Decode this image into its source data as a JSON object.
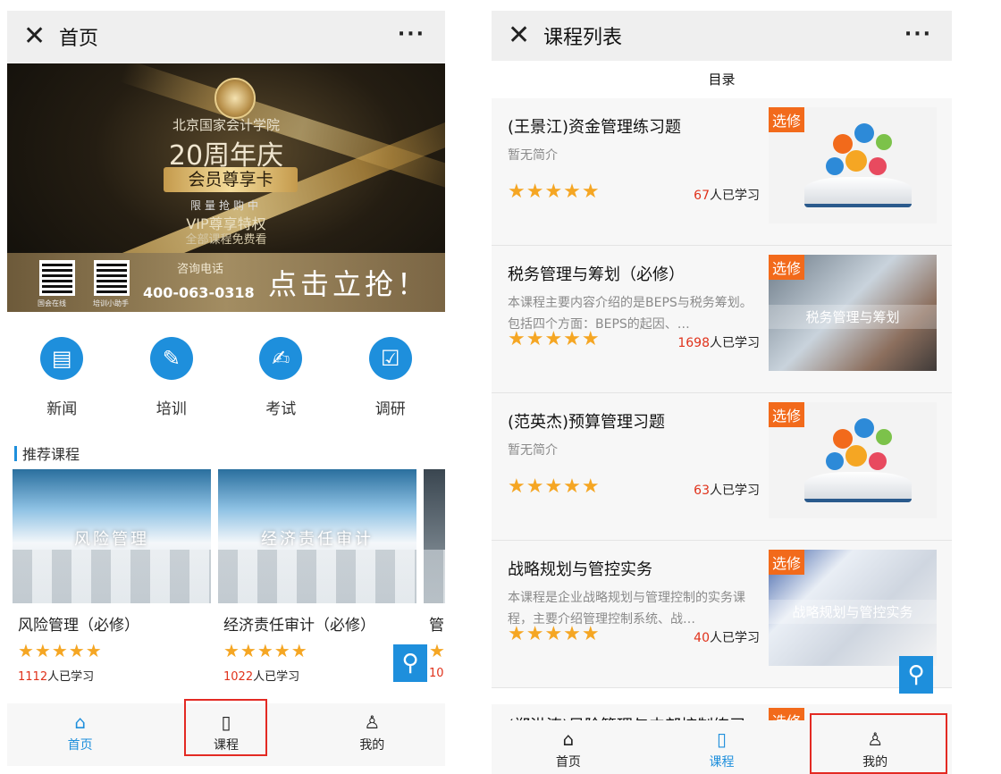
{
  "left": {
    "header": {
      "close_glyph": "✕",
      "title": "首页",
      "more_glyph": "···"
    },
    "banner": {
      "school": "北京国家会计学院",
      "anniversary": "20周年庆",
      "card": "会员尊享卡",
      "limited": "限量抢购中",
      "vip": "VIP尊享特权",
      "free": "全部课程免费看",
      "consult": "咨询电话",
      "phone": "400-063-0318",
      "grab": "点击立抢！",
      "qr1_label": "国会在线",
      "qr2_label": "培训小助手"
    },
    "shortcuts": [
      {
        "label": "新闻",
        "icon": "news-icon",
        "glyph": "▤"
      },
      {
        "label": "培训",
        "icon": "training-icon",
        "glyph": "✎"
      },
      {
        "label": "考试",
        "icon": "exam-icon",
        "glyph": "✍"
      },
      {
        "label": "调研",
        "icon": "survey-icon",
        "glyph": "☑"
      }
    ],
    "recommend_title": "推荐课程",
    "courses": [
      {
        "thumb_text": "风险管理",
        "name": "风险管理（必修）",
        "count": "1112",
        "suffix": "人已学习"
      },
      {
        "thumb_text": "经济责任审计",
        "name": "经济责任审计（必修）",
        "count": "1022",
        "suffix": "人已学习"
      },
      {
        "thumb_text": "",
        "name": "管",
        "count": "10",
        "suffix": ""
      }
    ],
    "stars": "★★★★★",
    "tabs": [
      {
        "label": "首页",
        "icon": "home-icon",
        "glyph": "⌂"
      },
      {
        "label": "课程",
        "icon": "book-icon",
        "glyph": "▯"
      },
      {
        "label": "我的",
        "icon": "user-icon",
        "glyph": "♙"
      }
    ]
  },
  "right": {
    "header": {
      "close_glyph": "✕",
      "title": "课程列表",
      "more_glyph": "···"
    },
    "catalog": "目录",
    "elective": "选修",
    "stars": "★★★★★",
    "items": [
      {
        "title": "(王景江)资金管理练习题",
        "desc": "暂无简介",
        "count": "67",
        "suffix": "人已学习",
        "image": "book",
        "img_text": ""
      },
      {
        "title": "税务管理与筹划（必修）",
        "desc": "本课程主要内容介绍的是BEPS与税务筹划。包括四个方面：BEPS的起因、…",
        "count": "1698",
        "suffix": "人已学习",
        "image": "photo1",
        "img_text": "税务管理与筹划"
      },
      {
        "title": "(范英杰)预算管理习题",
        "desc": "暂无简介",
        "count": "63",
        "suffix": "人已学习",
        "image": "book",
        "img_text": ""
      },
      {
        "title": "战略规划与管控实务",
        "desc": "本课程是企业战略规划与管理控制的实务课程，主要介绍管理控制系统、战…",
        "count": "40",
        "suffix": "人已学习",
        "image": "photo2",
        "img_text": "战略规划与管控实务"
      }
    ],
    "partial_title": "(郑洪涛)风险管理与内部控制练习",
    "tabs": [
      {
        "label": "首页",
        "icon": "home-icon",
        "glyph": "⌂"
      },
      {
        "label": "课程",
        "icon": "book-icon",
        "glyph": "▯"
      },
      {
        "label": "我的",
        "icon": "user-icon",
        "glyph": "♙"
      }
    ]
  },
  "colors": {
    "accent": "#1e8fdc",
    "elective": "#f26a1b",
    "star": "#f5a623",
    "count": "#e0321b",
    "highlight_box": "#e32a23"
  }
}
